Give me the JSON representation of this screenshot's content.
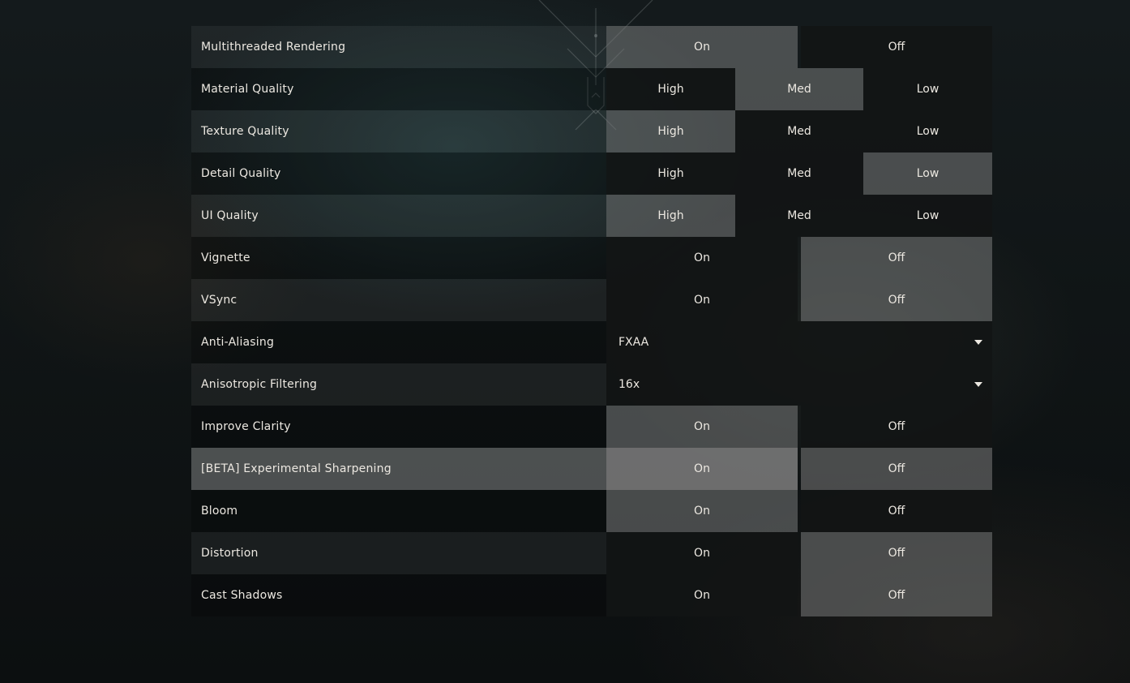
{
  "settings": [
    {
      "label": "Multithreaded Rendering",
      "type": "toggle",
      "options": [
        "On",
        "Off"
      ],
      "selected": 0
    },
    {
      "label": "Material Quality",
      "type": "tri",
      "options": [
        "High",
        "Med",
        "Low"
      ],
      "selected": 1
    },
    {
      "label": "Texture Quality",
      "type": "tri",
      "options": [
        "High",
        "Med",
        "Low"
      ],
      "selected": 0
    },
    {
      "label": "Detail Quality",
      "type": "tri",
      "options": [
        "High",
        "Med",
        "Low"
      ],
      "selected": 2
    },
    {
      "label": "UI Quality",
      "type": "tri",
      "options": [
        "High",
        "Med",
        "Low"
      ],
      "selected": 0
    },
    {
      "label": "Vignette",
      "type": "toggle",
      "options": [
        "On",
        "Off"
      ],
      "selected": 1
    },
    {
      "label": "VSync",
      "type": "toggle",
      "options": [
        "On",
        "Off"
      ],
      "selected": 1
    },
    {
      "label": "Anti-Aliasing",
      "type": "dropdown",
      "value": "FXAA"
    },
    {
      "label": "Anisotropic Filtering",
      "type": "dropdown",
      "value": "16x"
    },
    {
      "label": "Improve Clarity",
      "type": "toggle",
      "options": [
        "On",
        "Off"
      ],
      "selected": 0
    },
    {
      "label": "[BETA] Experimental Sharpening",
      "type": "toggle",
      "options": [
        "On",
        "Off"
      ],
      "selected": 0,
      "hovered": true
    },
    {
      "label": "Bloom",
      "type": "toggle",
      "options": [
        "On",
        "Off"
      ],
      "selected": 0
    },
    {
      "label": "Distortion",
      "type": "toggle",
      "options": [
        "On",
        "Off"
      ],
      "selected": 1
    },
    {
      "label": "Cast Shadows",
      "type": "toggle",
      "options": [
        "On",
        "Off"
      ],
      "selected": 1
    }
  ],
  "icons": {
    "dropdown": "chevron-down-icon",
    "background": "agent-emblem-icon"
  }
}
